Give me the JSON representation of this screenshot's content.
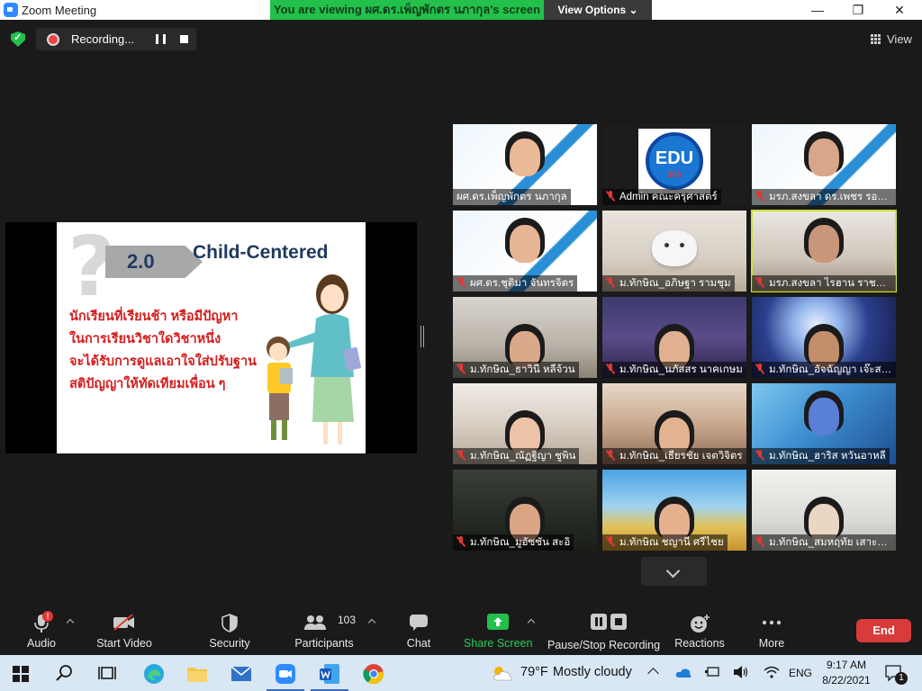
{
  "window": {
    "title": "Zoom Meeting",
    "minimize": "—",
    "maximize": "❐",
    "close": "✕"
  },
  "share_banner": {
    "viewing_text": "You are viewing ผศ.ดร.เพ็ญพักตร นภากุล's screen",
    "view_options": "View Options ⌄"
  },
  "top_bar": {
    "recording_label": "Recording...",
    "view_label": "View"
  },
  "slide": {
    "version": "2.0",
    "heading": "Child-Centered",
    "lines": [
      "นักเรียนที่เรียนช้า หรือมีปัญหา",
      "ในการเรียนวิชาใดวิชาหนึ่ง",
      "จะได้รับการดูแลเอาใจใส่ปรับฐาน",
      "สติปัญญาให้ทัดเทียมเพื่อน ๆ"
    ]
  },
  "participants": [
    {
      "name": "ผศ.ดร.เพ็ญพักตร นภากุล",
      "muted": false
    },
    {
      "name": "Admin คณะครุศาสตร์",
      "muted": true
    },
    {
      "name": "มรภ.สงขลา ดร.เพชร รองพล",
      "muted": true
    },
    {
      "name": "ผศ.ดร.ชุติมา จันทรจิตร",
      "muted": true
    },
    {
      "name": "ม.ทักษิณ_อภิษฐา รามชุม",
      "muted": true
    },
    {
      "name": "มรภ.สงขลา ไรฮาน ราชแก้ว",
      "muted": true
    },
    {
      "name": "ม.ทักษิณ_ธาวินี หลีจ้วน",
      "muted": true
    },
    {
      "name": "ม.ทักษิณ_นภัสสร นาคเกษม",
      "muted": true
    },
    {
      "name": "ม.ทักษิณ_อัจฉัญญา เจ๊ะสว่าง",
      "muted": true
    },
    {
      "name": "ม.ทักษิณ_ณัฏฐิญา ชูพิน",
      "muted": true
    },
    {
      "name": "ม.ทักษิณ_เธียรชัย เจตวิจิตร",
      "muted": true
    },
    {
      "name": "ม.ทักษิณ_ฮาริส หวันอาหลี",
      "muted": true
    },
    {
      "name": "ม.ทักษิณ_มูอัซซัน สะอิ",
      "muted": true
    },
    {
      "name": "ม.ทักษิณ ชญานี ศรีไชย",
      "muted": true
    },
    {
      "name": "ม.ทักษิณ_สมหฤทัย เสาะสุวรรณ",
      "muted": true
    }
  ],
  "edu_logo": {
    "top": "Education Faculty",
    "main": "EDU",
    "sub": "360"
  },
  "toolbar": {
    "audio": "Audio",
    "start_video": "Start Video",
    "security": "Security",
    "participants": "Participants",
    "participants_count": "103",
    "chat": "Chat",
    "share_screen": "Share Screen",
    "pause_stop_recording": "Pause/Stop Recording",
    "reactions": "Reactions",
    "more": "More",
    "end": "End",
    "audio_alert": "!"
  },
  "taskbar": {
    "temperature": "79°F",
    "weather": "Mostly cloudy",
    "language": "ENG",
    "time": "9:17 AM",
    "date": "8/22/2021",
    "notification_count": "1"
  },
  "colors": {
    "share_green": "#23c04b",
    "end_red": "#d83b3b",
    "mute_red": "#e53535",
    "active_speaker": "#c8e33a"
  }
}
